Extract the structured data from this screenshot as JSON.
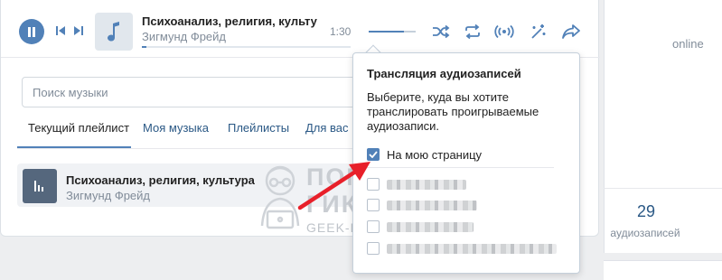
{
  "player": {
    "track_title": "Психоанализ, религия, культу",
    "track_artist": "Зигмунд Фрейд",
    "time": "1:30",
    "progress": 0.02,
    "volume": 0.75,
    "icons": [
      "pause-icon",
      "prev-icon",
      "next-icon",
      "music-note-icon",
      "shuffle-icon",
      "repeat-icon",
      "broadcast-icon",
      "recommend-icon",
      "share-icon"
    ],
    "accent_color": "#5181b8"
  },
  "search": {
    "placeholder": "Поиск музыки"
  },
  "tabs": [
    {
      "label": "Текущий плейлист",
      "active": true
    },
    {
      "label": "Моя музыка",
      "active": false
    },
    {
      "label": "Плейлисты",
      "active": false
    },
    {
      "label": "Для вас",
      "active": false
    }
  ],
  "track_row": {
    "title": "Психоанализ, религия, культура",
    "artist": "Зигмунд Фрейд"
  },
  "popup": {
    "title": "Трансляция аудиозаписей",
    "description": "Выберите, куда вы хотите транслировать проигрываемые аудиозаписи.",
    "options": [
      {
        "label": "На мою страницу",
        "checked": true
      }
    ]
  },
  "profile": {
    "status": "online",
    "audio_count": "29",
    "audio_label": "аудиозаписей"
  },
  "watermark": {
    "line1": "ПОМОЩЬ",
    "line2": "ГИКА",
    "line3": "GEEK-HELP.RU"
  },
  "annotation_color": "#e8202a"
}
